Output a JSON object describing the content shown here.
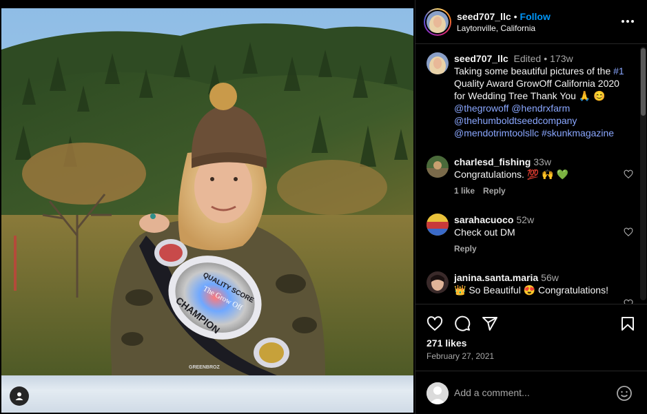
{
  "post": {
    "username": "seed707_llc",
    "follow_label": "Follow",
    "location": "Laytonville, California",
    "caption_user": "seed707_llc",
    "caption_edited": "Edited",
    "caption_time": "173w",
    "caption_text_1": "Taking some beautiful pictures of the ",
    "caption_hashtag_1": "#1",
    "caption_text_2": " Quality Award GrowOff California 2020 for Wedding Tree Thank You 🙏 😊 ",
    "caption_mentions": "@thegrowoff @hendrxfarm @thehumboldtseedcompany @mendotrimtoolsllc #skunkmagazine",
    "likes": "271 likes",
    "date": "February 27, 2021",
    "photo_belt_text_1": "QUALITY SCORE",
    "photo_belt_text_2": "The Grow Off",
    "photo_belt_text_3": "CHAMPION",
    "photo_shirt_text": "GREENBROZ"
  },
  "comments": [
    {
      "user": "charlesd_fishing",
      "time": "33w",
      "text": "Congratulations. 💯 🙌 💚",
      "likes": "1 like",
      "reply": "Reply"
    },
    {
      "user": "sarahacuoco",
      "time": "52w",
      "text": "Check out DM",
      "likes": "",
      "reply": "Reply"
    },
    {
      "user": "janina.santa.maria",
      "time": "56w",
      "text": "👑 So Beautiful 😍 Congratulations!",
      "likes": "",
      "reply": ""
    }
  ],
  "add_comment": {
    "placeholder": "Add a comment..."
  },
  "icons": {
    "like": "heart-icon",
    "comment": "comment-icon",
    "share": "paper-plane-icon",
    "save": "bookmark-icon",
    "more": "more-horizontal-icon",
    "emoji": "smiley-icon",
    "tag": "user-tag-icon"
  },
  "colors": {
    "accent": "#0095f6",
    "link": "#8aa7ff",
    "background": "#000000",
    "muted": "#a8a8a8"
  }
}
